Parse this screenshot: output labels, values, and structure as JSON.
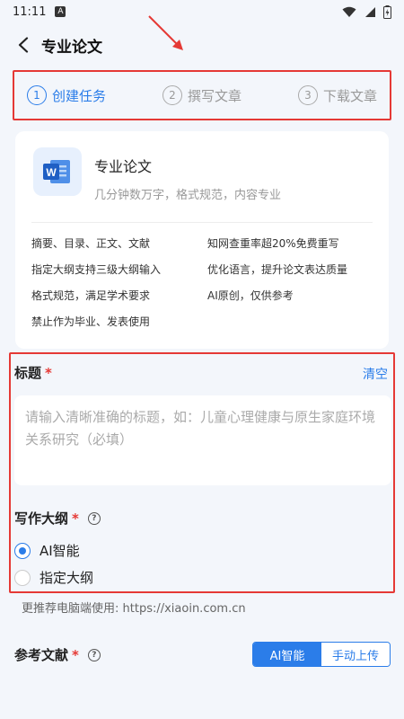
{
  "status_bar": {
    "time": "11:11",
    "notification_badge": "A"
  },
  "header": {
    "title": "专业论文"
  },
  "steps": [
    {
      "number": "1",
      "label": "创建任务"
    },
    {
      "number": "2",
      "label": "撰写文章"
    },
    {
      "number": "3",
      "label": "下载文章"
    }
  ],
  "product_card": {
    "title": "专业论文",
    "subtitle": "几分钟数万字，格式规范，内容专业",
    "icon_letter": "W",
    "features": [
      "摘要、目录、正文、文献",
      "知网查重率超20%免费重写",
      "指定大纲支持三级大纲输入",
      "优化语言，提升论文表达质量",
      "格式规范，满足学术要求",
      "AI原创，仅供参考",
      "禁止作为毕业、发表使用"
    ]
  },
  "form": {
    "title_label": "标题",
    "required_mark": "*",
    "clear_label": "清空",
    "title_placeholder": "请输入清晰准确的标题，如：儿童心理健康与原生家庭环境关系研究（必填）",
    "outline_label": "写作大纲",
    "outline_options": [
      "AI智能",
      "指定大纲"
    ]
  },
  "recommend_text": "更推荐电脑端使用: https://xiaoin.com.cn",
  "references": {
    "label": "参考文献",
    "options": [
      "AI智能",
      "手动上传"
    ]
  },
  "colors": {
    "accent": "#2b7de9",
    "highlight_box": "#e53935"
  }
}
